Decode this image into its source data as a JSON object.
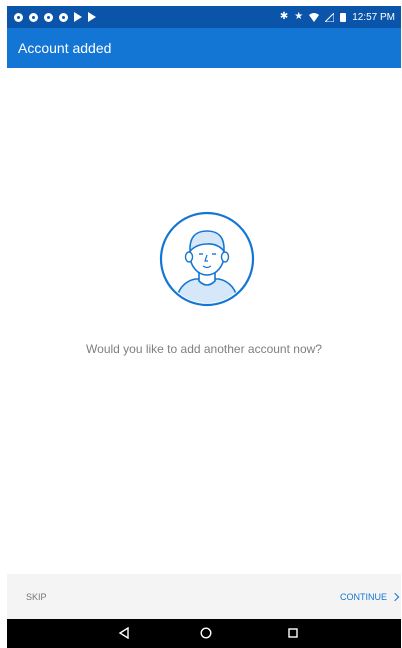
{
  "status_bar": {
    "time": "12:57 PM",
    "bluetooth_glyph": "✱",
    "star_glyph": "★"
  },
  "app_bar": {
    "title": "Account added"
  },
  "content": {
    "avatar_icon": "person-avatar-icon",
    "prompt": "Would you like to add another account now?"
  },
  "actions": {
    "skip_label": "SKIP",
    "continue_label": "CONTINUE"
  },
  "nav": {
    "back_icon": "back-triangle-icon",
    "home_icon": "home-circle-icon",
    "recents_icon": "recents-square-icon"
  },
  "colors": {
    "status_bar": "#0a55aa",
    "app_bar": "#1476d4",
    "accent": "#1476d4",
    "prompt_text": "#7f7f7f"
  }
}
